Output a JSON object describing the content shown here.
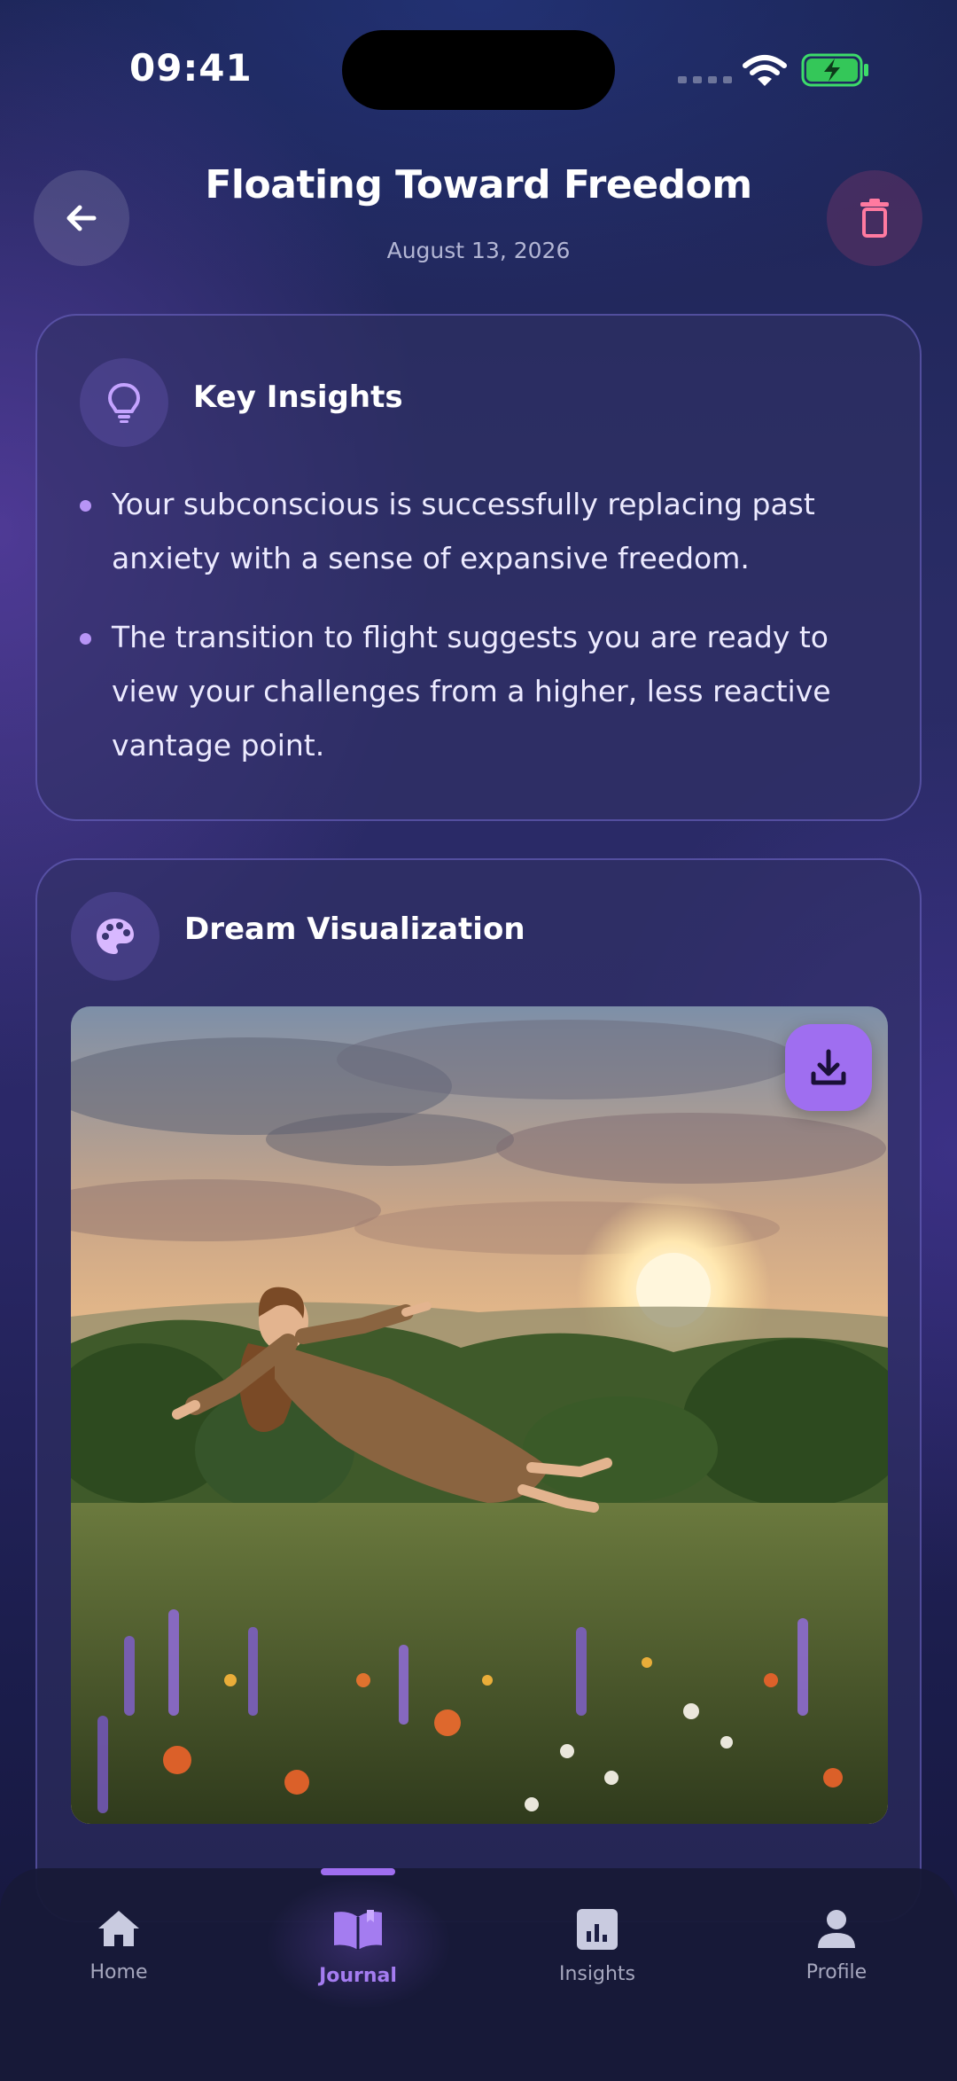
{
  "status_bar": {
    "time": "09:41"
  },
  "header": {
    "title": "Floating Toward Freedom",
    "date": "August 13, 2026",
    "back_icon": "arrow-left-icon",
    "delete_icon": "trash-icon"
  },
  "insights": {
    "title": "Key Insights",
    "icon": "lightbulb-icon",
    "items": [
      "Your subconscious is successfully replacing past anxiety with a sense of expansive freedom.",
      "The transition to flight suggests you are ready to view your challenges from a higher, less reactive vantage point."
    ]
  },
  "visualization": {
    "title": "Dream Visualization",
    "icon": "palette-icon",
    "image_subject": "woman floating above a wildflower meadow at sunset",
    "download_icon": "download-icon"
  },
  "nav": {
    "items": [
      {
        "label": "Home",
        "icon": "home-icon"
      },
      {
        "label": "Journal",
        "icon": "book-open-icon",
        "active": true
      },
      {
        "label": "Insights",
        "icon": "bar-chart-icon"
      },
      {
        "label": "Profile",
        "icon": "user-icon"
      }
    ]
  },
  "colors": {
    "accent": "#9f6ef0",
    "bullet": "#b794f6",
    "card_border": "#8278e6"
  }
}
